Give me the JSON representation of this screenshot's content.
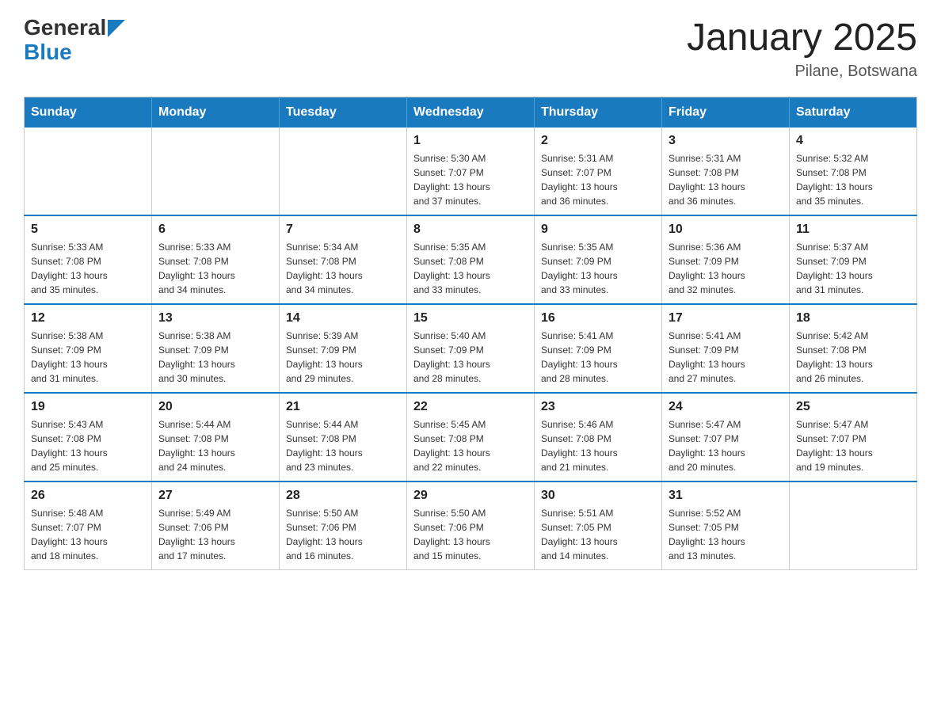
{
  "logo": {
    "general": "General",
    "blue": "Blue"
  },
  "title": "January 2025",
  "subtitle": "Pilane, Botswana",
  "days_of_week": [
    "Sunday",
    "Monday",
    "Tuesday",
    "Wednesday",
    "Thursday",
    "Friday",
    "Saturday"
  ],
  "weeks": [
    [
      {
        "day": "",
        "info": ""
      },
      {
        "day": "",
        "info": ""
      },
      {
        "day": "",
        "info": ""
      },
      {
        "day": "1",
        "info": "Sunrise: 5:30 AM\nSunset: 7:07 PM\nDaylight: 13 hours\nand 37 minutes."
      },
      {
        "day": "2",
        "info": "Sunrise: 5:31 AM\nSunset: 7:07 PM\nDaylight: 13 hours\nand 36 minutes."
      },
      {
        "day": "3",
        "info": "Sunrise: 5:31 AM\nSunset: 7:08 PM\nDaylight: 13 hours\nand 36 minutes."
      },
      {
        "day": "4",
        "info": "Sunrise: 5:32 AM\nSunset: 7:08 PM\nDaylight: 13 hours\nand 35 minutes."
      }
    ],
    [
      {
        "day": "5",
        "info": "Sunrise: 5:33 AM\nSunset: 7:08 PM\nDaylight: 13 hours\nand 35 minutes."
      },
      {
        "day": "6",
        "info": "Sunrise: 5:33 AM\nSunset: 7:08 PM\nDaylight: 13 hours\nand 34 minutes."
      },
      {
        "day": "7",
        "info": "Sunrise: 5:34 AM\nSunset: 7:08 PM\nDaylight: 13 hours\nand 34 minutes."
      },
      {
        "day": "8",
        "info": "Sunrise: 5:35 AM\nSunset: 7:08 PM\nDaylight: 13 hours\nand 33 minutes."
      },
      {
        "day": "9",
        "info": "Sunrise: 5:35 AM\nSunset: 7:09 PM\nDaylight: 13 hours\nand 33 minutes."
      },
      {
        "day": "10",
        "info": "Sunrise: 5:36 AM\nSunset: 7:09 PM\nDaylight: 13 hours\nand 32 minutes."
      },
      {
        "day": "11",
        "info": "Sunrise: 5:37 AM\nSunset: 7:09 PM\nDaylight: 13 hours\nand 31 minutes."
      }
    ],
    [
      {
        "day": "12",
        "info": "Sunrise: 5:38 AM\nSunset: 7:09 PM\nDaylight: 13 hours\nand 31 minutes."
      },
      {
        "day": "13",
        "info": "Sunrise: 5:38 AM\nSunset: 7:09 PM\nDaylight: 13 hours\nand 30 minutes."
      },
      {
        "day": "14",
        "info": "Sunrise: 5:39 AM\nSunset: 7:09 PM\nDaylight: 13 hours\nand 29 minutes."
      },
      {
        "day": "15",
        "info": "Sunrise: 5:40 AM\nSunset: 7:09 PM\nDaylight: 13 hours\nand 28 minutes."
      },
      {
        "day": "16",
        "info": "Sunrise: 5:41 AM\nSunset: 7:09 PM\nDaylight: 13 hours\nand 28 minutes."
      },
      {
        "day": "17",
        "info": "Sunrise: 5:41 AM\nSunset: 7:09 PM\nDaylight: 13 hours\nand 27 minutes."
      },
      {
        "day": "18",
        "info": "Sunrise: 5:42 AM\nSunset: 7:08 PM\nDaylight: 13 hours\nand 26 minutes."
      }
    ],
    [
      {
        "day": "19",
        "info": "Sunrise: 5:43 AM\nSunset: 7:08 PM\nDaylight: 13 hours\nand 25 minutes."
      },
      {
        "day": "20",
        "info": "Sunrise: 5:44 AM\nSunset: 7:08 PM\nDaylight: 13 hours\nand 24 minutes."
      },
      {
        "day": "21",
        "info": "Sunrise: 5:44 AM\nSunset: 7:08 PM\nDaylight: 13 hours\nand 23 minutes."
      },
      {
        "day": "22",
        "info": "Sunrise: 5:45 AM\nSunset: 7:08 PM\nDaylight: 13 hours\nand 22 minutes."
      },
      {
        "day": "23",
        "info": "Sunrise: 5:46 AM\nSunset: 7:08 PM\nDaylight: 13 hours\nand 21 minutes."
      },
      {
        "day": "24",
        "info": "Sunrise: 5:47 AM\nSunset: 7:07 PM\nDaylight: 13 hours\nand 20 minutes."
      },
      {
        "day": "25",
        "info": "Sunrise: 5:47 AM\nSunset: 7:07 PM\nDaylight: 13 hours\nand 19 minutes."
      }
    ],
    [
      {
        "day": "26",
        "info": "Sunrise: 5:48 AM\nSunset: 7:07 PM\nDaylight: 13 hours\nand 18 minutes."
      },
      {
        "day": "27",
        "info": "Sunrise: 5:49 AM\nSunset: 7:06 PM\nDaylight: 13 hours\nand 17 minutes."
      },
      {
        "day": "28",
        "info": "Sunrise: 5:50 AM\nSunset: 7:06 PM\nDaylight: 13 hours\nand 16 minutes."
      },
      {
        "day": "29",
        "info": "Sunrise: 5:50 AM\nSunset: 7:06 PM\nDaylight: 13 hours\nand 15 minutes."
      },
      {
        "day": "30",
        "info": "Sunrise: 5:51 AM\nSunset: 7:05 PM\nDaylight: 13 hours\nand 14 minutes."
      },
      {
        "day": "31",
        "info": "Sunrise: 5:52 AM\nSunset: 7:05 PM\nDaylight: 13 hours\nand 13 minutes."
      },
      {
        "day": "",
        "info": ""
      }
    ]
  ]
}
